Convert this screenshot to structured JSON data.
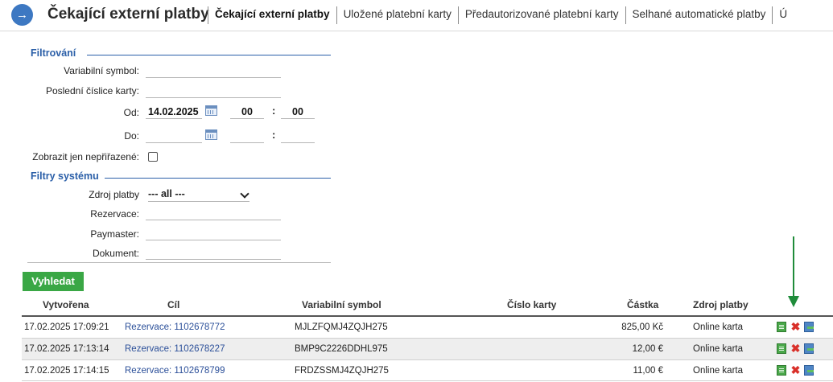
{
  "header": {
    "title": "Čekající externí platby",
    "tabs": [
      {
        "label": "Čekající externí platby",
        "active": true
      },
      {
        "label": "Uložené platební karty",
        "active": false
      },
      {
        "label": "Předautorizované platební karty",
        "active": false
      },
      {
        "label": "Selhané automatické platby",
        "active": false
      },
      {
        "label": "Ú",
        "active": false
      }
    ]
  },
  "filters": {
    "section_title": "Filtrování",
    "variable_symbol": {
      "label": "Variabilní symbol:",
      "value": ""
    },
    "card_digits": {
      "label": "Poslední číslice karty:",
      "value": ""
    },
    "from": {
      "label": "Od:",
      "date": "14.02.2025",
      "hour": "00",
      "minute": "00"
    },
    "to": {
      "label": "Do:",
      "date": "",
      "hour": "",
      "minute": ""
    },
    "time_separator": ":",
    "unassigned_only": {
      "label": "Zobrazit jen nepřiřazené:",
      "checked": false
    }
  },
  "system_filters": {
    "section_title": "Filtry systému",
    "payment_source": {
      "label": "Zdroj platby",
      "selected": "--- all ---"
    },
    "reservation": {
      "label": "Rezervace:",
      "value": ""
    },
    "paymaster": {
      "label": "Paymaster:",
      "value": ""
    },
    "document": {
      "label": "Dokument:",
      "value": ""
    }
  },
  "search_button": "Vyhledat",
  "table": {
    "headers": [
      "Vytvořena",
      "Cíl",
      "Variabilní symbol",
      "Číslo karty",
      "Částka",
      "Zdroj platby"
    ],
    "rows": [
      {
        "created": "17.02.2025 17:09:21",
        "target": "Rezervace: 1102678772",
        "vs": "MJLZFQMJ4ZQJH275",
        "card": "",
        "amount": "825,00 Kč",
        "source": "Online karta"
      },
      {
        "created": "17.02.2025 17:13:14",
        "target": "Rezervace: 1102678227",
        "vs": "BMP9C2226DDHL975",
        "card": "",
        "amount": "12,00 €",
        "source": "Online karta"
      },
      {
        "created": "17.02.2025 17:14:15",
        "target": "Rezervace: 1102678799",
        "vs": "FRDZSSMJ4ZQJH275",
        "card": "",
        "amount": "11,00 €",
        "source": "Online karta"
      }
    ]
  },
  "icons": {
    "back": "arrow-right-circle-icon",
    "calendar": "calendar-icon",
    "detail": "document-icon",
    "cancel": "close-icon",
    "export": "export-icon"
  },
  "colors": {
    "accent_blue": "#2b5fa8",
    "search_green": "#3aa745",
    "cancel_red": "#d9302a",
    "annotation_arrow": "#1f8c3a"
  }
}
